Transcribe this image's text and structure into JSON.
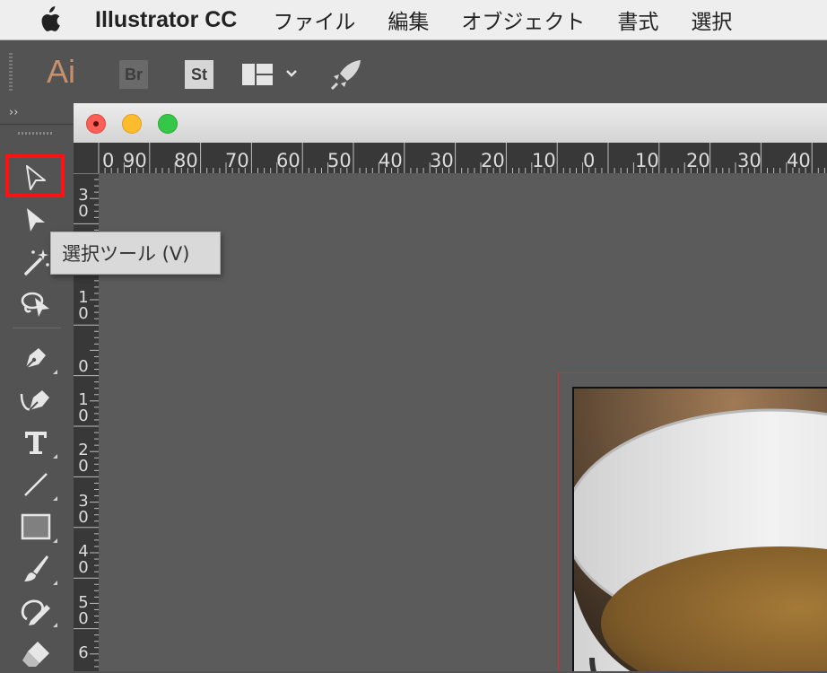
{
  "menubar": {
    "app_name": "Illustrator CC",
    "menus": [
      "ファイル",
      "編集",
      "オブジェクト",
      "書式",
      "選択"
    ]
  },
  "appbar": {
    "logo": "Ai",
    "bridge_label": "Br",
    "stock_label": "St",
    "workspace_icon": "layout-grid-icon",
    "sync_icon": "rocket-icon"
  },
  "tools": {
    "collapse_label": "››",
    "tooltip": "選択ツール (V)",
    "items": [
      {
        "name": "selection-tool",
        "icon": "arrow-outline-icon"
      },
      {
        "name": "direct-selection-tool",
        "icon": "arrow-solid-icon"
      },
      {
        "name": "magic-wand-tool",
        "icon": "magic-wand-icon"
      },
      {
        "name": "lasso-tool",
        "icon": "lasso-icon"
      },
      {
        "name": "pen-tool",
        "icon": "pen-icon"
      },
      {
        "name": "curvature-tool",
        "icon": "curvature-pen-icon"
      },
      {
        "name": "type-tool",
        "icon": "type-icon"
      },
      {
        "name": "line-segment-tool",
        "icon": "line-icon"
      },
      {
        "name": "rectangle-tool",
        "icon": "rectangle-icon"
      },
      {
        "name": "paintbrush-tool",
        "icon": "paintbrush-icon"
      },
      {
        "name": "shaper-tool",
        "icon": "shaper-icon"
      },
      {
        "name": "eraser-tool",
        "icon": "eraser-icon"
      }
    ]
  },
  "ruler": {
    "horizontal": [
      "0",
      "90",
      "80",
      "70",
      "60",
      "50",
      "40",
      "30",
      "20",
      "10",
      "0",
      "10",
      "20",
      "30",
      "40"
    ],
    "vertical": [
      "3\n0",
      "1\n0",
      "0",
      "1\n0",
      "2\n0",
      "3\n0",
      "4\n0",
      "5\n0",
      "6"
    ]
  },
  "colors": {
    "highlight": "#ff1212",
    "artboard_guide": "#e02a2a",
    "ai_brand": "#c78f6c"
  }
}
